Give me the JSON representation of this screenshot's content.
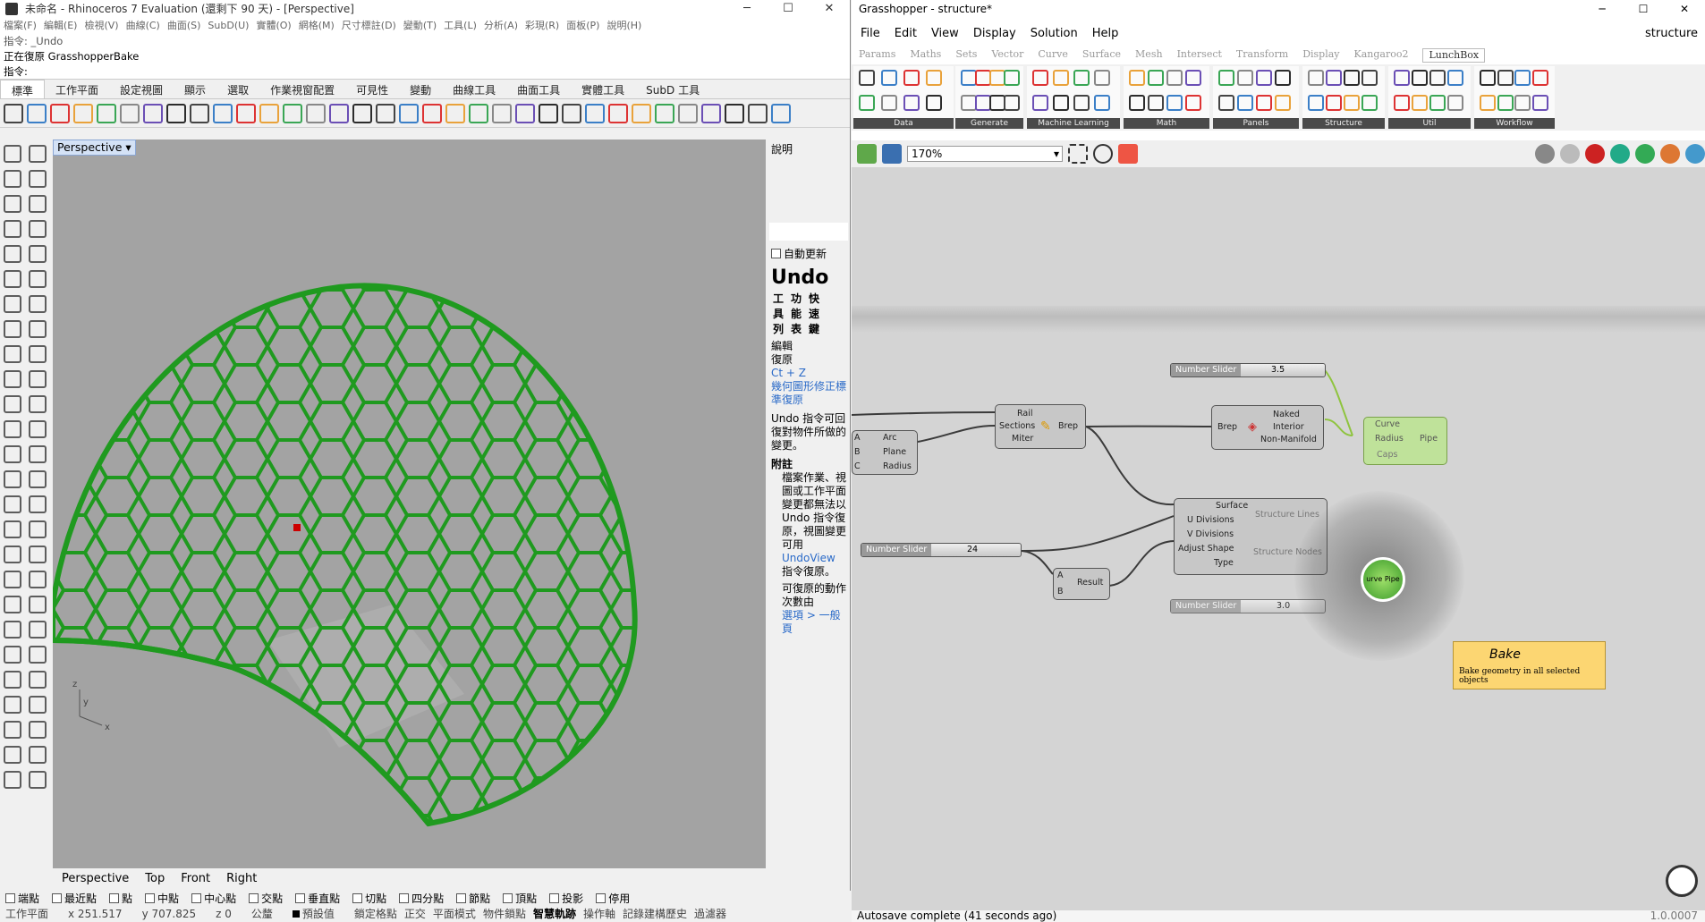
{
  "rhino": {
    "title": "未命名 - Rhinoceros 7 Evaluation (還剩下 90 天) - [Perspective]",
    "menu": [
      "檔案(F)",
      "編輯(E)",
      "檢視(V)",
      "曲線(C)",
      "曲面(S)",
      "SubD(U)",
      "實體(O)",
      "網格(M)",
      "尺寸標註(D)",
      "變動(T)",
      "工具(L)",
      "分析(A)",
      "彩現(R)",
      "面板(P)",
      "說明(H)"
    ],
    "history_1": "指令: _Undo",
    "history_2": "正在復原 GrasshopperBake",
    "prompt": "指令:",
    "tabs": [
      "標準",
      "工作平面",
      "設定視圖",
      "顯示",
      "選取",
      "作業視窗配置",
      "可見性",
      "變動",
      "曲線工具",
      "曲面工具",
      "實體工具",
      "SubD 工具"
    ],
    "viewport_title": "Perspective",
    "viewport_tabs": [
      "Perspective",
      "Top",
      "Front",
      "Right"
    ],
    "axis": {
      "x": "x",
      "y": "y",
      "z": "z"
    },
    "right_panel": {
      "header": "說明",
      "auto_update": "自動更新",
      "heading": "Undo",
      "cols": [
        "工具列",
        "功能表",
        "快速鍵"
      ],
      "row_menu": "編輯",
      "row_menu2": "復原",
      "row_key": "Ct + Z",
      "link": "幾何圖形修正標準復原",
      "desc": "Undo 指令可回復對物件所做的變更。",
      "note_head": "附註",
      "note1": "檔案作業、視圖或工作平面變更都無法以 Undo 指令復原，視圖變更可用",
      "note_link": "UndoView",
      "note1b": "指令復原。",
      "note2": "可復原的動作次數由",
      "note2_link": "選項 > 一般頁"
    },
    "osnap": [
      "端點",
      "最近點",
      "點",
      "中點",
      "中心點",
      "交點",
      "垂直點",
      "切點",
      "四分點",
      "節點",
      "頂點",
      "投影",
      "停用"
    ],
    "status": {
      "plane": "工作平面",
      "x": "x 251.517",
      "y": "y 707.825",
      "z": "z 0",
      "unit": "公釐",
      "layer": "預設值",
      "modes": [
        "鎖定格點",
        "正交",
        "平面模式",
        "物件鎖點",
        "智慧軌跡",
        "操作軸",
        "記錄建構歷史",
        "過濾器"
      ]
    }
  },
  "gh": {
    "title": "Grasshopper - structure*",
    "menu": [
      "File",
      "Edit",
      "View",
      "Display",
      "Solution",
      "Help"
    ],
    "doc_name": "structure",
    "tabs": [
      "Params",
      "Maths",
      "Sets",
      "Vector",
      "Curve",
      "Surface",
      "Mesh",
      "Intersect",
      "Transform",
      "Display",
      "Kangaroo2",
      "LunchBox"
    ],
    "active_tab": "LunchBox",
    "groups": [
      "Data",
      "Generate",
      "Machine Learning",
      "Math",
      "Panels",
      "Structure",
      "Util",
      "Workflow"
    ],
    "zoom": "170%",
    "components": {
      "sweep": {
        "in": [
          "Rail",
          "Sections",
          "Miter"
        ],
        "out": "Brep"
      },
      "arc": {
        "in": [
          "A",
          "B",
          "C"
        ],
        "out": [
          "Arc",
          "Plane",
          "Radius"
        ]
      },
      "edges": {
        "in": "Brep",
        "out": [
          "Naked",
          "Interior",
          "Non-Manifold"
        ]
      },
      "structure": {
        "in": [
          "Surface",
          "U Divisions",
          "V Divisions",
          "Adjust Shape",
          "Type"
        ],
        "out": [
          "Structure Lines",
          "Structure Nodes"
        ]
      },
      "mult": {
        "in": [
          "A",
          "B"
        ],
        "out": "Result"
      },
      "pipe": {
        "in": [
          "Curve",
          "Radius",
          "Caps"
        ],
        "out": "Pipe"
      }
    },
    "sliders": [
      {
        "name": "Number Slider",
        "value": "3.5"
      },
      {
        "name": "Number Slider",
        "value": "24"
      },
      {
        "name": "Number Slider",
        "value": "3.0"
      }
    ],
    "tooltip": {
      "title": "Bake",
      "desc": "Bake geometry in all selected objects"
    },
    "radial_center": "urve Pipe",
    "status": "Autosave complete (41 seconds ago)",
    "version": "1.0.0007"
  }
}
